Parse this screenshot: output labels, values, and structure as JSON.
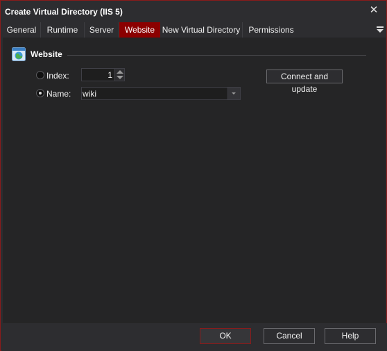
{
  "window": {
    "title": "Create Virtual Directory (IIS 5)",
    "close_glyph": "✕",
    "accent_color": "#8b0000"
  },
  "tabs": [
    {
      "label": "General",
      "active": false
    },
    {
      "label": "Runtime",
      "active": false
    },
    {
      "label": "Server",
      "active": false
    },
    {
      "label": "Website",
      "active": true
    },
    {
      "label": "New Virtual Directory",
      "active": false
    },
    {
      "label": "Permissions",
      "active": false
    }
  ],
  "group": {
    "title": "Website",
    "icon": "website-icon"
  },
  "form": {
    "index_label": "Index:",
    "index_value": "1",
    "index_selected": false,
    "name_label": "Name:",
    "name_value": "wiki",
    "name_selected": true,
    "connect_label": "Connect and update"
  },
  "footer": {
    "ok_label": "OK",
    "cancel_label": "Cancel",
    "help_label": "Help"
  }
}
